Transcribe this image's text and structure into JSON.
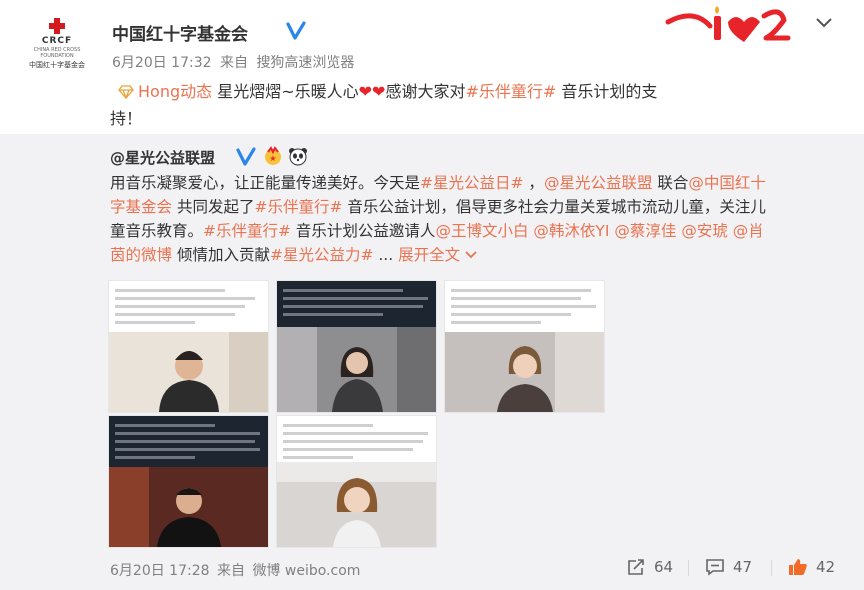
{
  "post": {
    "author": "中国红十字基金会",
    "time": "6月20日 17:32",
    "source_prefix": "来自",
    "source": "搜狗高速浏览器",
    "logo": {
      "abbr": "CRCF",
      "sub": "CHINA RED CROSS FOUNDATION",
      "cn": "中国红十字基金会"
    },
    "text": {
      "tag": "Hong动态",
      "part1": "星光熠熠~乐暖人心",
      "hearts": "❤❤",
      "part2": "感谢大家对",
      "topic": "#乐伴童行#",
      "part3": " 音乐计划的支",
      "part4": "持！"
    }
  },
  "repost": {
    "author": "@星光公益联盟",
    "lines": [
      [
        {
          "t": "用音乐凝聚爱心，让正能量传递美好。今天是"
        },
        {
          "t": "#星光公益日#",
          "link": true
        },
        {
          "t": " ，"
        },
        {
          "t": "@星光公益联盟",
          "link": true
        },
        {
          "t": " 联合"
        },
        {
          "t": "@中国红十",
          "link": true
        }
      ],
      [
        {
          "t": "字基金会",
          "link": true
        },
        {
          "t": " 共同发起了"
        },
        {
          "t": "#乐伴童行#",
          "link": true
        },
        {
          "t": " 音乐公益计划，倡导更多社会力量关爱城市流动儿童，关注儿"
        }
      ],
      [
        {
          "t": "童音乐教育。"
        },
        {
          "t": "#乐伴童行#",
          "link": true
        },
        {
          "t": " 音乐计划公益邀请人"
        },
        {
          "t": "@王博文小白",
          "link": true
        },
        {
          "t": " "
        },
        {
          "t": "@韩沐依YI",
          "link": true
        },
        {
          "t": " "
        },
        {
          "t": "@蔡淳佳",
          "link": true
        },
        {
          "t": " "
        },
        {
          "t": "@安琥",
          "link": true
        },
        {
          "t": " "
        },
        {
          "t": "@肖",
          "link": true
        }
      ],
      [
        {
          "t": "茵的微博",
          "link": true
        },
        {
          "t": " 倾情加入贡献"
        },
        {
          "t": "#星光公益力#",
          "link": true
        },
        {
          "t": " ... "
        },
        {
          "t": "展开全文",
          "link": true
        }
      ]
    ],
    "time": "6月20日 17:28",
    "source_prefix": "来自",
    "source": "微博 weibo.com",
    "actions": {
      "repost": "64",
      "comment": "47",
      "like": "42"
    }
  },
  "colors": {
    "link": "#eb7350",
    "text": "#333333",
    "meta": "#808080",
    "repost_bg": "#f2f2f5",
    "heart": "#e8242b"
  },
  "icons": [
    "crcf-logo",
    "verified-icon",
    "chevron-down-icon",
    "diamond-icon",
    "heart-icon",
    "star-badge-icon",
    "panda-icon",
    "repost-icon",
    "comment-icon",
    "like-icon"
  ]
}
